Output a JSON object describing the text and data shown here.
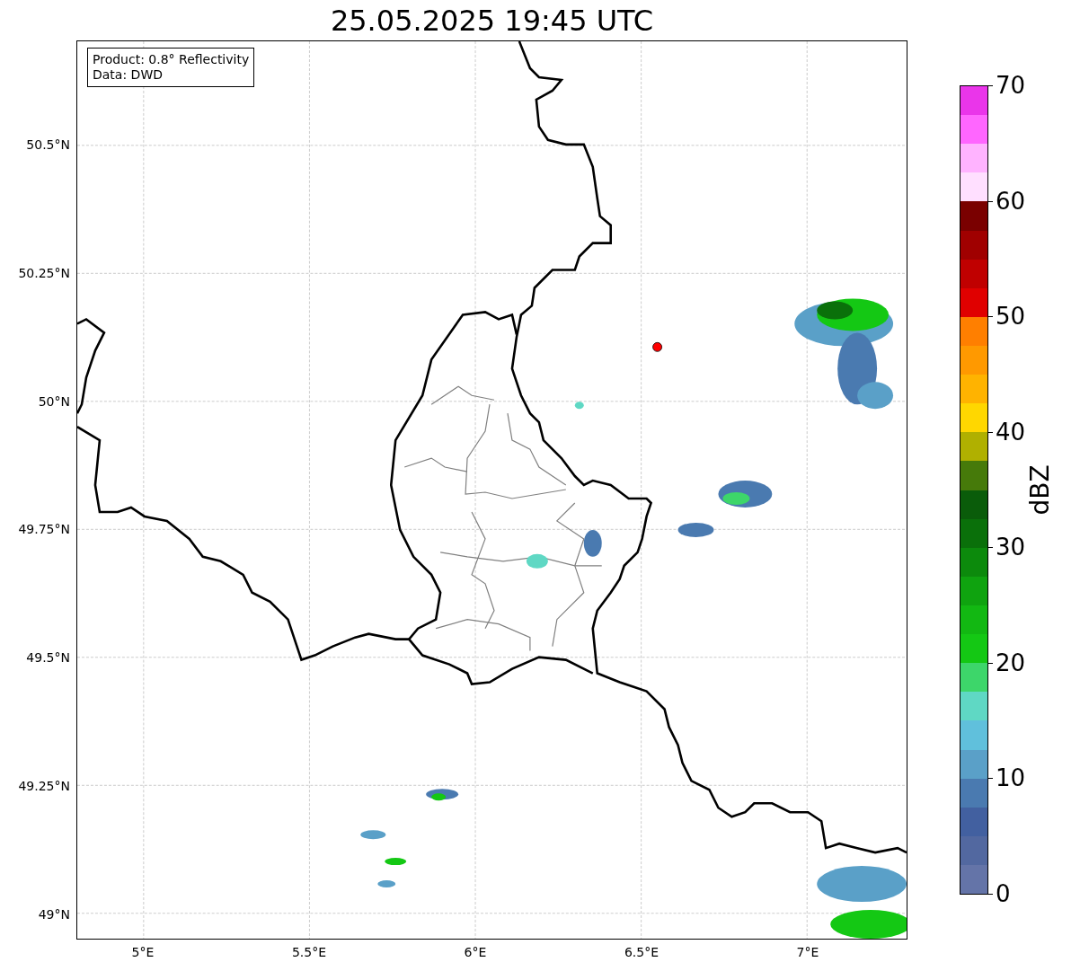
{
  "title": "25.05.2025 19:45 UTC",
  "map": {
    "legend": [
      "Product: 0.8° Reflectivity",
      "Data: DWD"
    ],
    "x_ticks": [
      "5°E",
      "5.5°E",
      "6°E",
      "6.5°E",
      "7°E"
    ],
    "y_ticks": [
      "50.5°N",
      "50.25°N",
      "50°N",
      "49.75°N",
      "49.5°N",
      "49.25°N",
      "49°N"
    ]
  },
  "colorbar": {
    "label": "dBZ",
    "ticks": [
      "70",
      "60",
      "50",
      "40",
      "30",
      "20",
      "10",
      "0"
    ],
    "segments": [
      {
        "color": "#ea35ea"
      },
      {
        "color": "#ff66ff"
      },
      {
        "color": "#ffb3ff"
      },
      {
        "color": "#ffdfff"
      },
      {
        "color": "#7a0000"
      },
      {
        "color": "#a00000"
      },
      {
        "color": "#c00000"
      },
      {
        "color": "#e00000"
      },
      {
        "color": "#ff7f00"
      },
      {
        "color": "#ff9900"
      },
      {
        "color": "#ffb300"
      },
      {
        "color": "#ffd700"
      },
      {
        "color": "#b0b000"
      },
      {
        "color": "#467a0a"
      },
      {
        "color": "#0a5c0a"
      },
      {
        "color": "#0a700a"
      },
      {
        "color": "#0c8a0c"
      },
      {
        "color": "#0fa30f"
      },
      {
        "color": "#12b812"
      },
      {
        "color": "#14c814"
      },
      {
        "color": "#3dd66a"
      },
      {
        "color": "#5fd8c4"
      },
      {
        "color": "#60c0dc"
      },
      {
        "color": "#5aa0c8"
      },
      {
        "color": "#4a7ab0"
      },
      {
        "color": "#4260a0"
      },
      {
        "color": "#5268a0"
      },
      {
        "color": "#6474a8"
      }
    ]
  }
}
